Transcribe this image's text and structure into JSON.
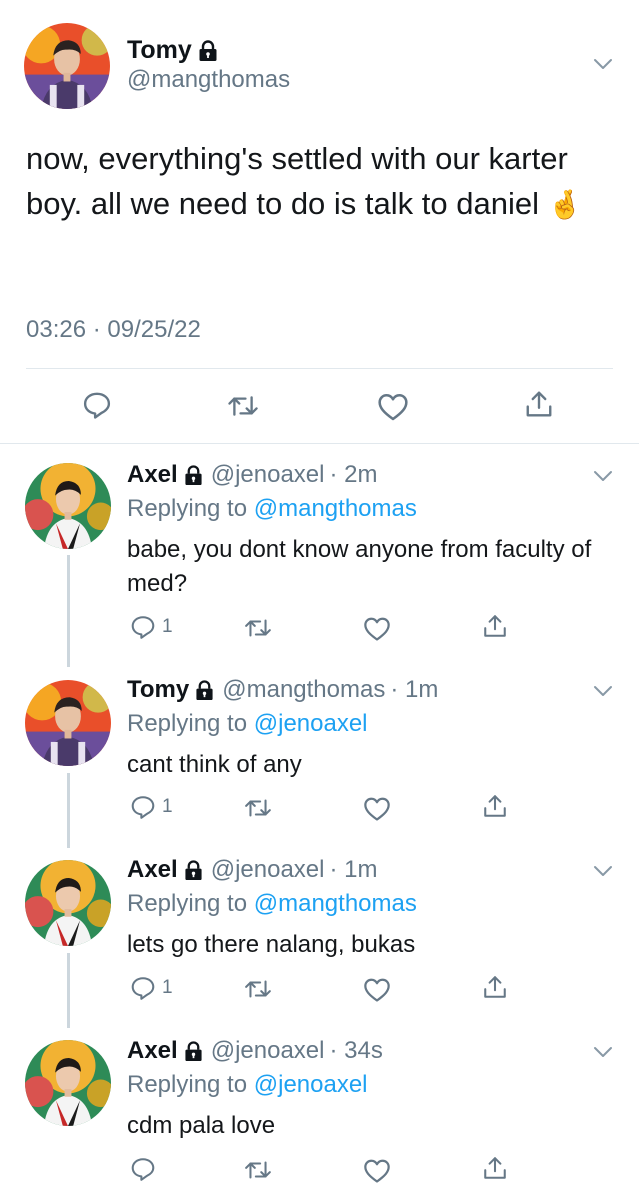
{
  "main_tweet": {
    "name": "Tomy",
    "handle": "@mangthomas",
    "text": "now, everything's settled with our karter boy. all we need to do is talk to daniel",
    "emoji": "🤞",
    "timestamp": "03:26 · 09/25/22"
  },
  "replies": [
    {
      "name": "Axel",
      "handle": "@jenoaxel",
      "time": "· 2m",
      "replying_prefix": "Replying to",
      "replying_to": "@mangthomas",
      "text": "babe, you dont know anyone from faculty of med?",
      "reply_count": "1"
    },
    {
      "name": "Tomy",
      "handle": "@mangthomas",
      "time": "· 1m",
      "replying_prefix": "Replying to",
      "replying_to": "@jenoaxel",
      "text": "cant think of any",
      "reply_count": "1"
    },
    {
      "name": "Axel",
      "handle": "@jenoaxel",
      "time": "· 1m",
      "replying_prefix": "Replying to",
      "replying_to": "@mangthomas",
      "text": "lets go there nalang, bukas",
      "reply_count": "1"
    },
    {
      "name": "Axel",
      "handle": "@jenoaxel",
      "time": "· 34s",
      "replying_prefix": "Replying to",
      "replying_to": "@jenoaxel",
      "text": "cdm pala love",
      "reply_count": ""
    }
  ],
  "colors": {
    "link": "#1da1f2",
    "muted": "#657786",
    "icon": "#657786",
    "divider": "#e1e8ed"
  },
  "icons": [
    "lock-icon",
    "chevron-down-icon",
    "reply-icon",
    "retweet-icon",
    "like-icon",
    "share-icon"
  ]
}
